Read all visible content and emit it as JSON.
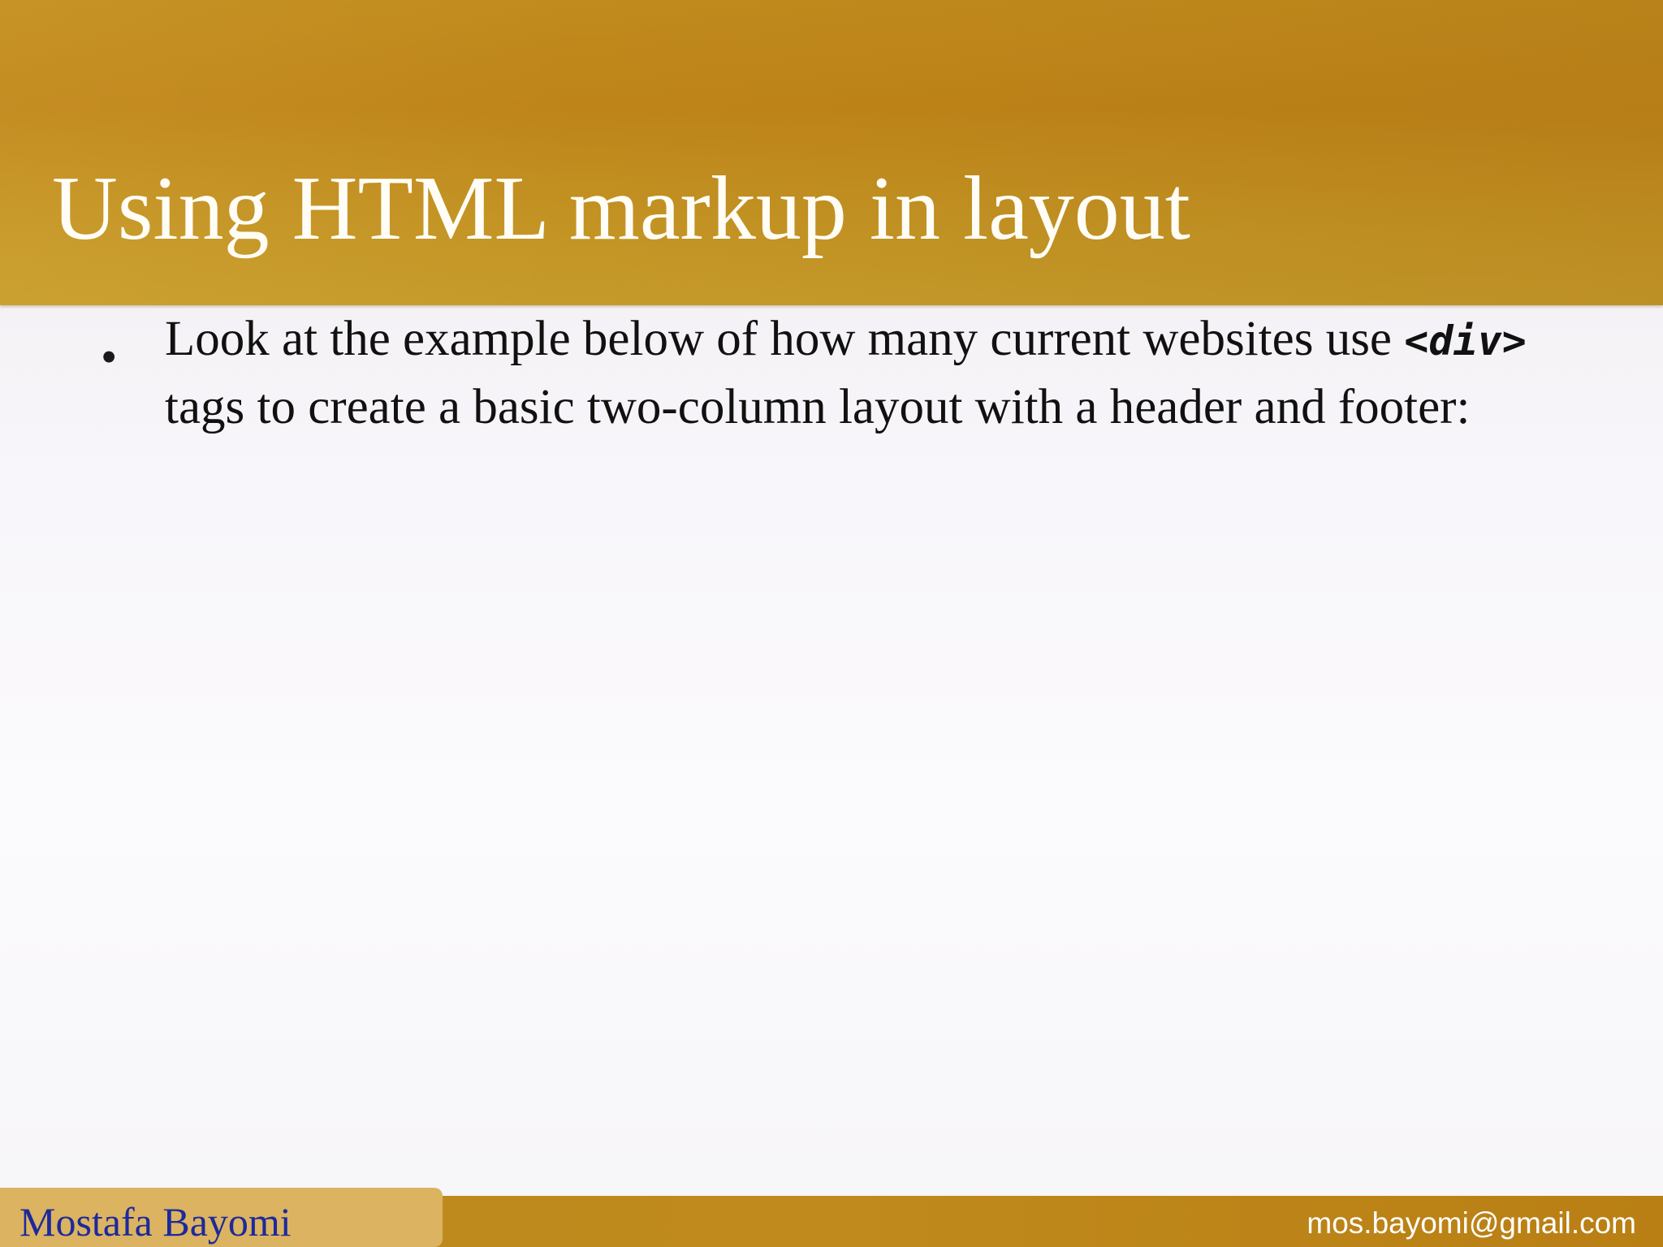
{
  "slide": {
    "title": "Using HTML markup in layout",
    "bullets": [
      {
        "text_before": "Look at the example below of how many current websites use ",
        "code": "<div>",
        "text_after": " tags to create a basic two-column layout with a header and footer:"
      }
    ]
  },
  "footer": {
    "author": "Mostafa Bayomi",
    "email": "mos.bayomi@gmail.com"
  },
  "colors": {
    "header_band": "#c18b1d",
    "title_text": "#fffdf6",
    "author_text": "#1c2a9c",
    "footer_band": "#bd8a1e",
    "author_box": "#dcb360"
  }
}
